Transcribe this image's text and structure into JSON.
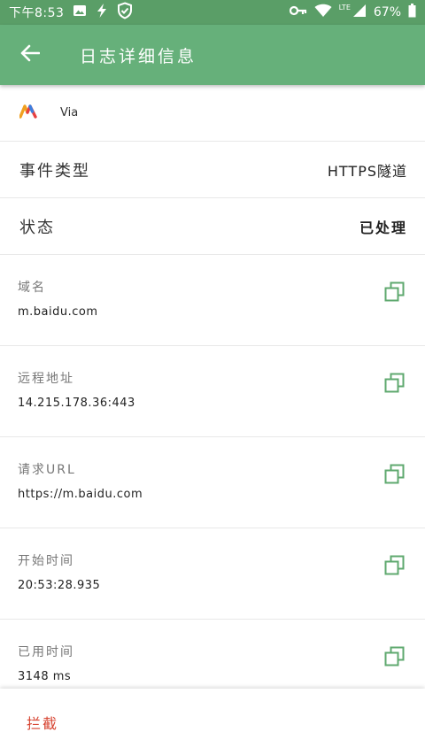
{
  "status_bar": {
    "time": "下午8:53",
    "lte": "LTE",
    "battery": "67%"
  },
  "app_bar": {
    "title": "日志详细信息"
  },
  "app": {
    "name": "Via"
  },
  "summary_rows": [
    {
      "label": "事件类型",
      "value": "HTTPS隧道"
    },
    {
      "label": "状态",
      "value": "已处理"
    }
  ],
  "detail_rows": [
    {
      "label": "域名",
      "value": "m.baidu.com"
    },
    {
      "label": "远程地址",
      "value": "14.215.178.36:443"
    },
    {
      "label": "请求URL",
      "value": "https://m.baidu.com"
    },
    {
      "label": "开始时间",
      "value": "20:53:28.935"
    },
    {
      "label": "已用时间",
      "value": "3148 ms"
    }
  ],
  "bottom": {
    "intercept_label": "拦截"
  },
  "colors": {
    "status_bar": "#5a9e67",
    "app_bar": "#66b07a",
    "copy_icon": "#5fa96f",
    "intercept": "#d64330"
  },
  "icons": {
    "back": "arrow-left-icon",
    "copy": "copy-icon",
    "image": "image-icon",
    "flash": "flash-icon",
    "shield": "shield-icon",
    "key": "key-icon",
    "wifi": "wifi-icon",
    "signal": "signal-icon",
    "battery": "battery-icon"
  }
}
